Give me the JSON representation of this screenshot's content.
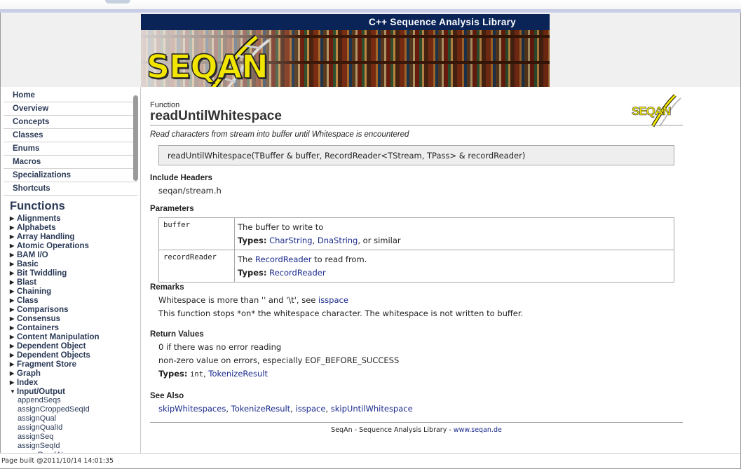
{
  "banner": {
    "tagline": "C++ Sequence Analysis Library",
    "logo_text": "SEQAN"
  },
  "sidebar": {
    "nav": [
      "Home",
      "Overview",
      "Concepts",
      "Classes",
      "Enums",
      "Macros",
      "Specializations",
      "Shortcuts"
    ],
    "functions_title": "Functions",
    "groups": [
      "Alignments",
      "Alphabets",
      "Array Handling",
      "Atomic Operations",
      "BAM I/O",
      "Basic",
      "Bit Twiddling",
      "Blast",
      "Chaining",
      "Class",
      "Comparisons",
      "Consensus",
      "Containers",
      "Content Manipulation",
      "Dependent Object",
      "Dependent Objects",
      "Fragment Store",
      "Graph",
      "Index"
    ],
    "open_group": "Input/Output",
    "sub_items": [
      "appendSeqs",
      "assignCroppedSeqId",
      "assignQual",
      "assignQualId",
      "assignSeq",
      "assignSeqId",
      "asyncReadAt"
    ]
  },
  "status_bar": "Page built @2011/10/14 14:01:35",
  "doc": {
    "kind": "Function",
    "title": "readUntilWhitespace",
    "logo_text": "SEQAN",
    "summary": "Read characters from stream into buffer until Whitespace is encountered",
    "signature": "readUntilWhitespace(TBuffer & buffer, RecordReader<TStream, TPass> & recordReader)",
    "include_headers_title": "Include Headers",
    "include_header": "seqan/stream.h",
    "parameters_title": "Parameters",
    "types_label": "Types:",
    "params": [
      {
        "name": "buffer",
        "desc": "The buffer to write to",
        "type_links": [
          "CharString",
          "DnaString"
        ],
        "type_suffix": ", or similar"
      },
      {
        "name": "recordReader",
        "desc_pre": "The ",
        "desc_link": "RecordReader",
        "desc_post": " to read from.",
        "type_links": [
          "RecordReader"
        ]
      }
    ],
    "remarks_title": "Remarks",
    "remarks_1_pre": "Whitespace is more than '' and '\\t', see ",
    "remarks_1_link": "isspace",
    "remarks_2": "This function stops *on* the whitespace character. The whitespace is not written to buffer.",
    "return_title": "Return Values",
    "return_1": "0 if there was no error reading",
    "return_2": "non-zero value on errors, especially EOF_BEFORE_SUCCESS",
    "return_type_code": "int",
    "return_type_link": "TokenizeResult",
    "see_also_title": "See Also",
    "see_also": [
      "skipWhitespaces",
      "TokenizeResult",
      "isspace",
      "skipUntilWhitespace"
    ],
    "footer_text": "SeqAn - Sequence Analysis Library - ",
    "footer_link": "www.seqan.de"
  }
}
